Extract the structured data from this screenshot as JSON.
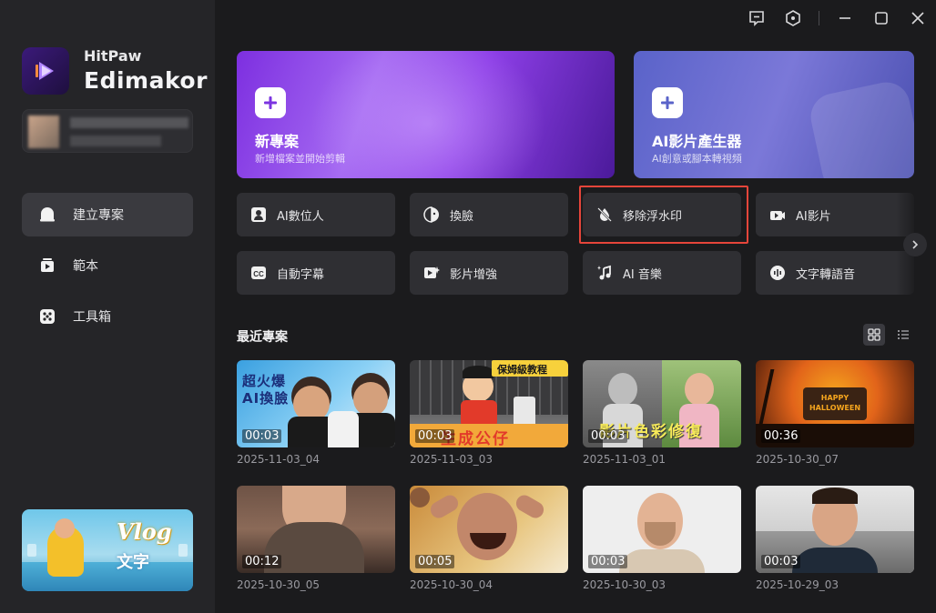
{
  "app": {
    "brand_small": "HitPaw",
    "brand_big": "Edimakor",
    "accent": "#8a3ff0"
  },
  "titlebar": {
    "icons": [
      "feedback-icon",
      "settings-icon",
      "minimize-icon",
      "maximize-icon",
      "close-icon"
    ]
  },
  "sidebar": {
    "items": [
      {
        "label": "建立專案",
        "icon": "create-project-icon",
        "active": true
      },
      {
        "label": "範本",
        "icon": "template-icon",
        "active": false
      },
      {
        "label": "工具箱",
        "icon": "toolbox-icon",
        "active": false
      }
    ],
    "promo": {
      "text1": "Vlog",
      "text2": "文字"
    }
  },
  "hero": {
    "new_project": {
      "title": "新專案",
      "subtitle": "新增檔案並開始剪輯"
    },
    "ai_generator": {
      "title": "AI影片產生器",
      "subtitle": "AI創意或腳本轉視頻"
    }
  },
  "tools": {
    "row1": [
      {
        "label": "AI數位人",
        "icon": "avatar-icon"
      },
      {
        "label": "換臉",
        "icon": "face-swap-icon"
      },
      {
        "label": "移除浮水印",
        "icon": "watermark-remove-icon"
      },
      {
        "label": "AI影片",
        "icon": "ai-video-icon"
      }
    ],
    "row2": [
      {
        "label": "自動字幕",
        "icon": "subtitle-icon"
      },
      {
        "label": "影片增強",
        "icon": "video-enhance-icon"
      },
      {
        "label": "AI 音樂",
        "icon": "music-icon"
      },
      {
        "label": "文字轉語音",
        "icon": "tts-icon"
      }
    ]
  },
  "recent": {
    "title": "最近專案",
    "projects": [
      {
        "name": "2025-11-03_04",
        "duration": "00:03",
        "overlay": "超火爆\nAI換臉"
      },
      {
        "name": "2025-11-03_03",
        "duration": "00:03",
        "overlay": "生成公仔",
        "badge": "保姆級教程"
      },
      {
        "name": "2025-11-03_01",
        "duration": "00:03",
        "overlay": "影片色彩修復"
      },
      {
        "name": "2025-10-30_07",
        "duration": "00:36",
        "overlay": "HAPPY HALLOWEEN"
      },
      {
        "name": "2025-10-30_05",
        "duration": "00:12"
      },
      {
        "name": "2025-10-30_04",
        "duration": "00:05"
      },
      {
        "name": "2025-10-30_03",
        "duration": "00:03"
      },
      {
        "name": "2025-10-29_03",
        "duration": "00:03"
      }
    ]
  }
}
